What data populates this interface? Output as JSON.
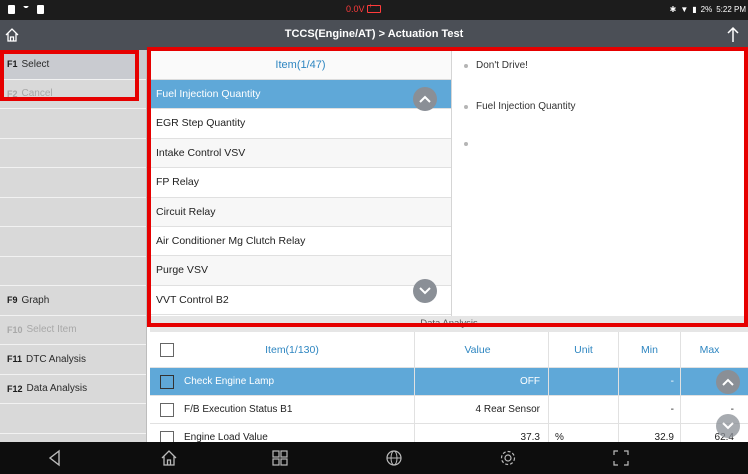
{
  "status_bar": {
    "voltage": "0.0V",
    "battery_percent": "2%",
    "time": "5:22 PM"
  },
  "title_bar": {
    "title": "TCCS(Engine/AT) > Actuation Test"
  },
  "sidebar": {
    "f1": {
      "key": "F1",
      "label": "Select"
    },
    "f2": {
      "key": "F2",
      "label": "Cancel"
    },
    "f9": {
      "key": "F9",
      "label": "Graph"
    },
    "f10": {
      "key": "F10",
      "label": "Select Item"
    },
    "f11": {
      "key": "F11",
      "label": "DTC Analysis"
    },
    "f12": {
      "key": "F12",
      "label": "Data Analysis"
    }
  },
  "item_list": {
    "header": "Item(1/47)",
    "rows": [
      "Fuel Injection Quantity",
      "EGR Step Quantity",
      "Intake Control VSV",
      "FP Relay",
      "Circuit Relay",
      "Air Conditioner Mg Clutch Relay",
      "Purge VSV",
      "VVT Control B2"
    ]
  },
  "info": {
    "line1": "Don't Drive!",
    "line2": "Fuel Injection Quantity",
    "line3": ""
  },
  "data_analysis": {
    "label": "Data Analysis",
    "headers": {
      "item": "Item(1/130)",
      "value": "Value",
      "unit": "Unit",
      "min": "Min",
      "max": "Max"
    },
    "rows": [
      {
        "item": "Check Engine Lamp",
        "value": "OFF",
        "unit": "",
        "min": "-",
        "max": "-"
      },
      {
        "item": "F/B Execution Status B1",
        "value": "4 Rear Sensor",
        "unit": "",
        "min": "-",
        "max": "-"
      },
      {
        "item": "Engine Load Value",
        "value": "37.3",
        "unit": "%",
        "min": "32.9",
        "max": "62.4"
      }
    ]
  },
  "colors": {
    "accent_blue": "#5fa8d8",
    "header_text_blue": "#2e86c1",
    "highlight_red": "#e60000",
    "voltage_red": "#ff3b3b"
  }
}
